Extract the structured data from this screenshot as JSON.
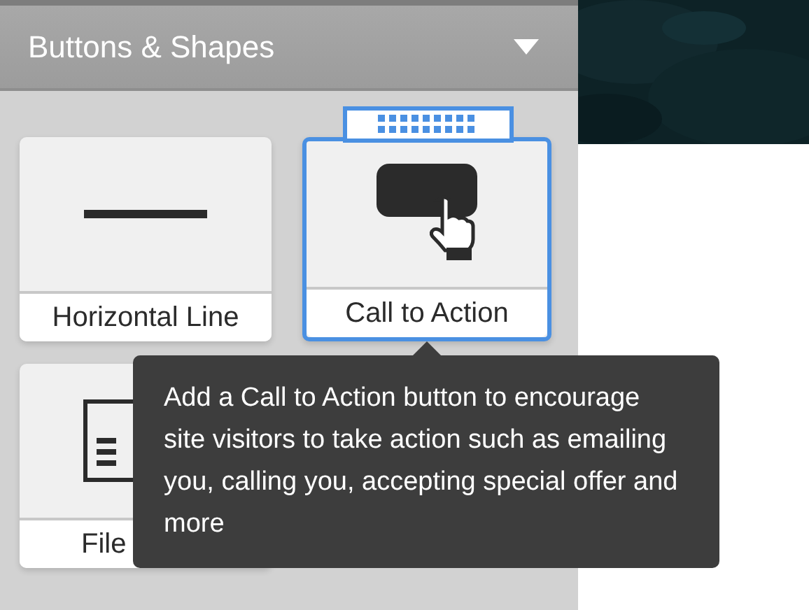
{
  "panel": {
    "title": "Buttons & Shapes",
    "expanded": true
  },
  "tiles": [
    {
      "kind": "line",
      "label": "Horizontal Line",
      "selected": false
    },
    {
      "kind": "cta",
      "label": "Call to Action",
      "selected": true
    },
    {
      "kind": "file",
      "label": "File",
      "selected": false
    }
  ],
  "tooltip": {
    "text": "Add a Call to Action button to encourage site visitors to take action such as emailing you, calling you, accepting special offer and more"
  }
}
